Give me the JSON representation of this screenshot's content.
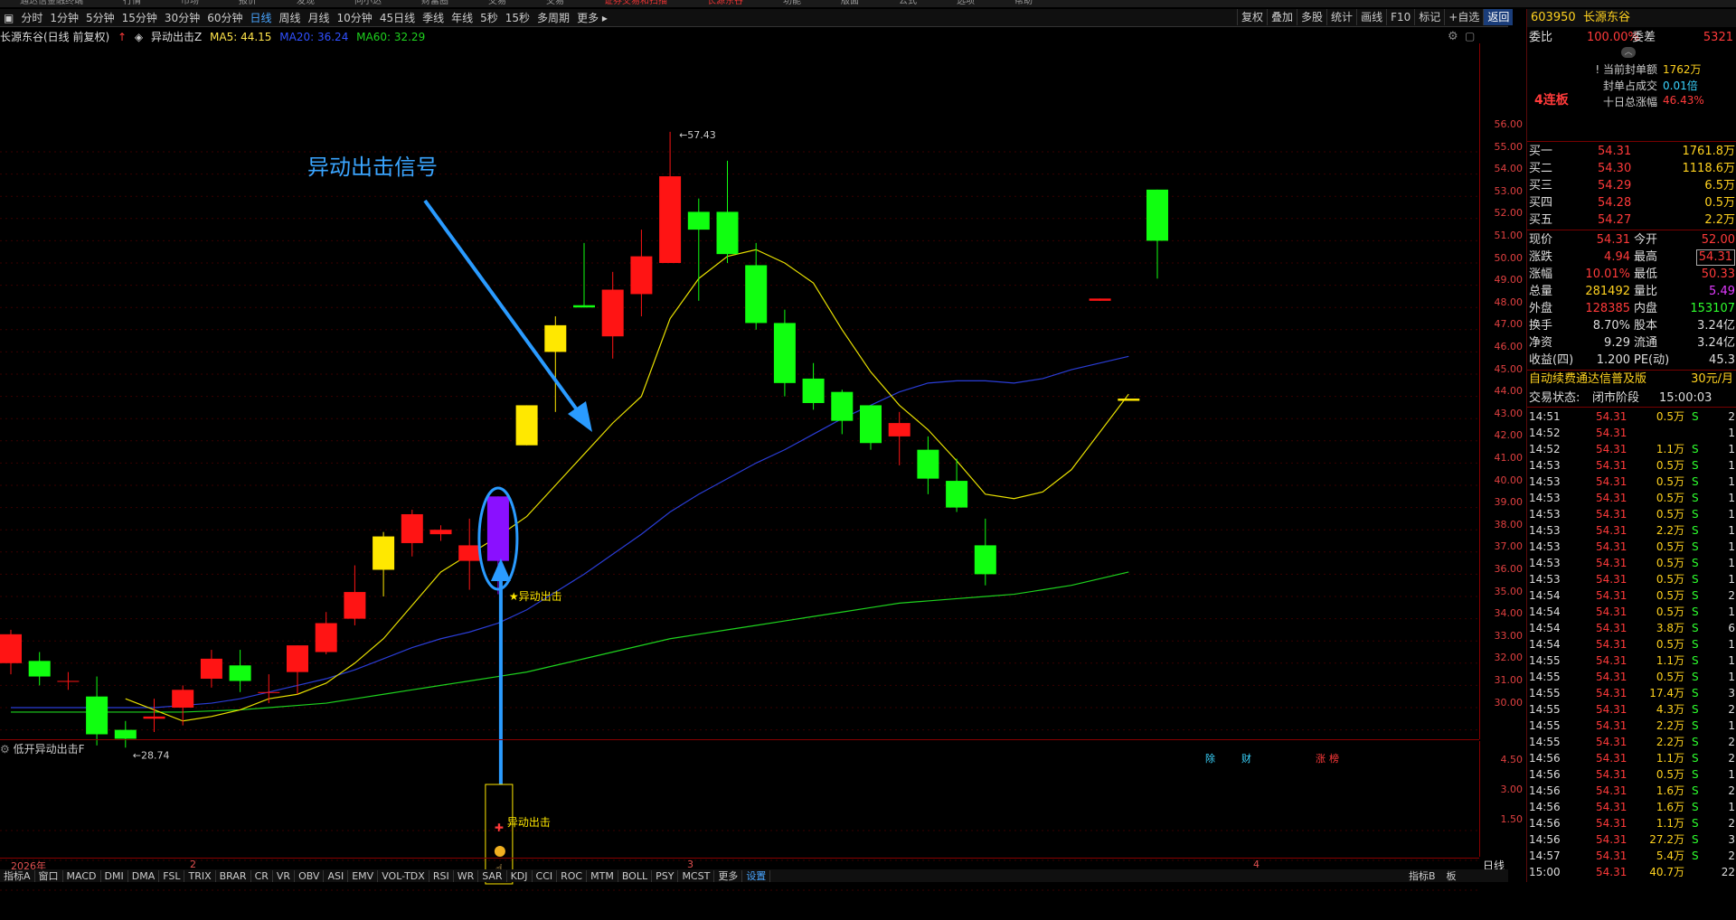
{
  "menubar": [
    "通达信金融终端",
    "行情",
    "市场",
    "报价",
    "发现",
    "问小达",
    "财富圈",
    "交易",
    "交易",
    "证券交易和扫描",
    "长源东谷",
    "功能",
    "版面",
    "公式",
    "选项",
    "帮助"
  ],
  "period_tabs": [
    {
      "label": "分时"
    },
    {
      "label": "1分钟"
    },
    {
      "label": "5分钟"
    },
    {
      "label": "15分钟"
    },
    {
      "label": "30分钟"
    },
    {
      "label": "60分钟"
    },
    {
      "label": "日线",
      "active": true
    },
    {
      "label": "周线"
    },
    {
      "label": "月线"
    },
    {
      "label": "10分钟"
    },
    {
      "label": "45日线"
    },
    {
      "label": "季线"
    },
    {
      "label": "年线"
    },
    {
      "label": "5秒"
    },
    {
      "label": "15秒"
    },
    {
      "label": "多周期"
    },
    {
      "label": "更多 ▸"
    }
  ],
  "toolbar": [
    "复权",
    "叠加",
    "多股",
    "统计",
    "画线",
    "F10",
    "标记",
    "+自选",
    "返回"
  ],
  "info_bar": {
    "stock": "长源东谷(日线 前复权)",
    "indicator": "异动出击Z",
    "ma5": "MA5: 44.15",
    "ma20": "MA20: 36.24",
    "ma60": "MA60: 32.29"
  },
  "chart_data": {
    "type": "candlestick",
    "high_label": "57.43",
    "low_label": "28.74",
    "annotation_title": "异动出击信号",
    "signal_label": "★异动出击",
    "event_tags": [
      "除",
      "财",
      "涨",
      "榜"
    ],
    "y_ticks": [
      "56.00",
      "55.00",
      "54.00",
      "53.00",
      "52.00",
      "51.00",
      "50.00",
      "49.00",
      "48.00",
      "47.00",
      "46.00",
      "45.00",
      "44.00",
      "43.00",
      "42.00",
      "41.00",
      "40.00",
      "39.00",
      "38.00",
      "37.00",
      "36.00",
      "35.00",
      "34.00",
      "33.00",
      "32.00",
      "31.00",
      "30.00"
    ],
    "x_labels": [
      "2026年",
      "2",
      "3",
      "4"
    ],
    "candles": [
      {
        "o": 33.0,
        "h": 34.5,
        "l": 32.5,
        "c": 34.3
      },
      {
        "o": 33.1,
        "h": 33.5,
        "l": 32.0,
        "c": 32.4
      },
      {
        "o": 32.2,
        "h": 32.6,
        "l": 31.8,
        "c": 32.2
      },
      {
        "o": 31.5,
        "h": 32.4,
        "l": 29.3,
        "c": 29.8
      },
      {
        "o": 30.0,
        "h": 30.4,
        "l": 29.2,
        "c": 29.6
      },
      {
        "o": 30.5,
        "h": 31.4,
        "l": 29.9,
        "c": 30.6
      },
      {
        "o": 31.0,
        "h": 32.0,
        "l": 30.2,
        "c": 31.8
      },
      {
        "o": 32.3,
        "h": 33.6,
        "l": 31.9,
        "c": 33.2
      },
      {
        "o": 32.9,
        "h": 33.6,
        "l": 31.7,
        "c": 32.2
      },
      {
        "o": 31.7,
        "h": 32.5,
        "l": 31.2,
        "c": 31.7
      },
      {
        "o": 32.6,
        "h": 33.8,
        "l": 31.6,
        "c": 33.8
      },
      {
        "o": 33.5,
        "h": 35.3,
        "l": 33.4,
        "c": 34.8
      },
      {
        "o": 35.0,
        "h": 37.4,
        "l": 34.7,
        "c": 36.2
      },
      {
        "o": 37.2,
        "h": 38.9,
        "l": 36.0,
        "c": 38.7
      },
      {
        "o": 38.4,
        "h": 39.9,
        "l": 37.8,
        "c": 39.7
      },
      {
        "o": 38.8,
        "h": 39.2,
        "l": 38.5,
        "c": 39.0
      },
      {
        "o": 37.6,
        "h": 39.5,
        "l": 36.3,
        "c": 38.3
      },
      {
        "o": 37.6,
        "h": 40.5,
        "l": 36.1,
        "c": 40.5,
        "signal": true
      },
      {
        "o": 42.8,
        "h": 44.6,
        "l": 42.8,
        "c": 44.6
      },
      {
        "o": 47.0,
        "h": 48.6,
        "l": 44.3,
        "c": 48.2
      },
      {
        "o": 49.1,
        "h": 51.9,
        "l": 49.0,
        "c": 49.0
      },
      {
        "o": 47.7,
        "h": 50.6,
        "l": 46.7,
        "c": 49.8
      },
      {
        "o": 49.6,
        "h": 52.5,
        "l": 48.6,
        "c": 51.3
      },
      {
        "o": 51.0,
        "h": 56.9,
        "l": 51.0,
        "c": 54.9
      },
      {
        "o": 53.3,
        "h": 53.9,
        "l": 49.3,
        "c": 52.5
      },
      {
        "o": 53.3,
        "h": 55.6,
        "l": 51.0,
        "c": 51.4
      },
      {
        "o": 50.9,
        "h": 51.9,
        "l": 48.0,
        "c": 48.3
      },
      {
        "o": 48.3,
        "h": 48.9,
        "l": 45.0,
        "c": 45.6
      },
      {
        "o": 45.8,
        "h": 46.5,
        "l": 44.4,
        "c": 44.7
      },
      {
        "o": 45.2,
        "h": 45.3,
        "l": 43.3,
        "c": 43.9
      },
      {
        "o": 44.6,
        "h": 44.6,
        "l": 42.6,
        "c": 42.9
      },
      {
        "o": 43.2,
        "h": 44.3,
        "l": 41.9,
        "c": 43.8
      },
      {
        "o": 42.6,
        "h": 43.2,
        "l": 40.6,
        "c": 41.3
      },
      {
        "o": 41.2,
        "h": 42.2,
        "l": 39.8,
        "c": 40.0
      },
      {
        "o": 38.3,
        "h": 39.5,
        "l": 36.5,
        "c": 37.0
      },
      null,
      null,
      null,
      {
        "o": 49.3,
        "h": 49.4,
        "l": 49.3,
        "c": 49.4
      },
      {
        "o": 44.8,
        "h": 44.9,
        "l": 44.8,
        "c": 44.9
      },
      {
        "o": 54.3,
        "h": 54.3,
        "l": 50.3,
        "c": 52.0
      }
    ],
    "ma5": [
      null,
      null,
      null,
      null,
      31.4,
      30.9,
      30.4,
      30.6,
      30.9,
      31.4,
      31.6,
      32.1,
      33.0,
      34.1,
      35.6,
      37.1,
      37.9,
      38.7,
      39.6,
      41.0,
      42.4,
      43.8,
      45.0,
      48.5,
      50.3,
      51.3,
      51.6,
      51.0,
      50.1,
      48.0,
      46.1,
      44.6,
      43.5,
      42.1,
      40.6,
      40.4,
      40.7,
      41.7,
      43.4,
      45.1
    ],
    "ma20": [
      31.0,
      31.0,
      31.0,
      31.0,
      31.0,
      31.0,
      31.1,
      31.2,
      31.4,
      31.7,
      32.0,
      32.3,
      32.7,
      33.2,
      33.7,
      34.1,
      34.4,
      34.8,
      35.4,
      36.2,
      37.0,
      37.9,
      38.8,
      39.8,
      40.6,
      41.3,
      42.0,
      42.6,
      43.3,
      44.0,
      44.6,
      45.2,
      45.6,
      45.7,
      45.7,
      45.6,
      45.8,
      46.2,
      46.5,
      46.8
    ],
    "ma60": [
      30.8,
      30.8,
      30.8,
      30.8,
      30.8,
      30.8,
      30.8,
      30.85,
      30.9,
      31.0,
      31.1,
      31.2,
      31.4,
      31.6,
      31.8,
      32.0,
      32.2,
      32.4,
      32.6,
      32.9,
      33.2,
      33.5,
      33.8,
      34.1,
      34.3,
      34.5,
      34.7,
      34.9,
      35.1,
      35.3,
      35.5,
      35.7,
      35.8,
      35.9,
      36.0,
      36.1,
      36.3,
      36.5,
      36.8,
      37.1
    ]
  },
  "sub_chart": {
    "title": "低开异动出击F",
    "signal_label": "异动出击",
    "y_ticks": [
      "4.50",
      "3.00",
      "1.50"
    ]
  },
  "bottom_tabs": [
    "指标A",
    "窗口",
    "MACD",
    "DMI",
    "DMA",
    "FSL",
    "TRIX",
    "BRAR",
    "CR",
    "VR",
    "OBV",
    "ASI",
    "EMV",
    "VOL-TDX",
    "RSI",
    "WR",
    "SAR",
    "KDJ",
    "CCI",
    "ROC",
    "MTM",
    "BOLL",
    "PSY",
    "MCST",
    "更多",
    "设置"
  ],
  "bottom_right": [
    "指标B",
    "板"
  ],
  "period_label": "日线",
  "quote": {
    "code": "603950",
    "name": "长源东谷",
    "weibi_label": "委比",
    "weibi_value": "100.00%",
    "weicha_label": "委差",
    "weicha_value": "5321",
    "streak": "4连板",
    "seal_lines": [
      {
        "label": "! 当前封单额",
        "value": "1762万"
      },
      {
        "label": "封单占成交",
        "value": "0.01倍"
      },
      {
        "label": "十日总涨幅",
        "value": "46.43%"
      }
    ],
    "bids": [
      {
        "label": "买一",
        "price": "54.31",
        "vol": "1761.8万"
      },
      {
        "label": "买二",
        "price": "54.30",
        "vol": "1118.6万"
      },
      {
        "label": "买三",
        "price": "54.29",
        "vol": "6.5万"
      },
      {
        "label": "买四",
        "price": "54.28",
        "vol": "0.5万"
      },
      {
        "label": "买五",
        "price": "54.27",
        "vol": "2.2万"
      }
    ],
    "stats": [
      {
        "l1": "现价",
        "v1": "54.31",
        "c1": "red",
        "l2": "今开",
        "v2": "52.00",
        "c2": "red"
      },
      {
        "l1": "涨跌",
        "v1": "4.94",
        "c1": "red",
        "l2": "最高",
        "v2": "54.31",
        "c2": "red"
      },
      {
        "l1": "涨幅",
        "v1": "10.01%",
        "c1": "red",
        "l2": "最低",
        "v2": "50.33",
        "c2": "red"
      },
      {
        "l1": "总量",
        "v1": "281492",
        "c1": "yel",
        "l2": "量比",
        "v2": "5.49",
        "c2": "mag"
      },
      {
        "l1": "外盘",
        "v1": "128385",
        "c1": "red",
        "l2": "内盘",
        "v2": "153107",
        "c2": "grn"
      },
      {
        "l1": "换手",
        "v1": "8.70%",
        "c1": "wht",
        "l2": "股本",
        "v2": "3.24亿",
        "c2": "wht"
      },
      {
        "l1": "净资",
        "v1": "9.29",
        "c1": "wht",
        "l2": "流通",
        "v2": "3.24亿",
        "c2": "wht"
      },
      {
        "l1": "收益(四)",
        "v1": "1.200",
        "c1": "wht",
        "l2": "PE(动)",
        "v2": "45.3",
        "c2": "wht"
      }
    ],
    "ad": "自动续费通达信普及版",
    "ad_price": "30元/月",
    "status_label": "交易状态:",
    "status": "闭市阶段",
    "status_time": "15:00:03",
    "ticks": [
      {
        "t": "14:51",
        "p": "54.31",
        "v": "0.5万",
        "s": "S",
        "n": "2"
      },
      {
        "t": "14:52",
        "p": "54.31",
        "v": "",
        "s": "",
        "n": "1"
      },
      {
        "t": "14:52",
        "p": "54.31",
        "v": "1.1万",
        "s": "S",
        "n": "1"
      },
      {
        "t": "14:53",
        "p": "54.31",
        "v": "0.5万",
        "s": "S",
        "n": "1"
      },
      {
        "t": "14:53",
        "p": "54.31",
        "v": "0.5万",
        "s": "S",
        "n": "1"
      },
      {
        "t": "14:53",
        "p": "54.31",
        "v": "0.5万",
        "s": "S",
        "n": "1"
      },
      {
        "t": "14:53",
        "p": "54.31",
        "v": "0.5万",
        "s": "S",
        "n": "1"
      },
      {
        "t": "14:53",
        "p": "54.31",
        "v": "2.2万",
        "s": "S",
        "n": "1"
      },
      {
        "t": "14:53",
        "p": "54.31",
        "v": "0.5万",
        "s": "S",
        "n": "1"
      },
      {
        "t": "14:53",
        "p": "54.31",
        "v": "0.5万",
        "s": "S",
        "n": "1"
      },
      {
        "t": "14:53",
        "p": "54.31",
        "v": "0.5万",
        "s": "S",
        "n": "1"
      },
      {
        "t": "14:54",
        "p": "54.31",
        "v": "0.5万",
        "s": "S",
        "n": "2"
      },
      {
        "t": "14:54",
        "p": "54.31",
        "v": "0.5万",
        "s": "S",
        "n": "1"
      },
      {
        "t": "14:54",
        "p": "54.31",
        "v": "3.8万",
        "s": "S",
        "n": "6"
      },
      {
        "t": "14:54",
        "p": "54.31",
        "v": "0.5万",
        "s": "S",
        "n": "1"
      },
      {
        "t": "14:55",
        "p": "54.31",
        "v": "1.1万",
        "s": "S",
        "n": "1"
      },
      {
        "t": "14:55",
        "p": "54.31",
        "v": "0.5万",
        "s": "S",
        "n": "1"
      },
      {
        "t": "14:55",
        "p": "54.31",
        "v": "17.4万",
        "s": "S",
        "n": "3"
      },
      {
        "t": "14:55",
        "p": "54.31",
        "v": "4.3万",
        "s": "S",
        "n": "2"
      },
      {
        "t": "14:55",
        "p": "54.31",
        "v": "2.2万",
        "s": "S",
        "n": "1"
      },
      {
        "t": "14:55",
        "p": "54.31",
        "v": "2.2万",
        "s": "S",
        "n": "2"
      },
      {
        "t": "14:56",
        "p": "54.31",
        "v": "1.1万",
        "s": "S",
        "n": "2"
      },
      {
        "t": "14:56",
        "p": "54.31",
        "v": "0.5万",
        "s": "S",
        "n": "1"
      },
      {
        "t": "14:56",
        "p": "54.31",
        "v": "1.6万",
        "s": "S",
        "n": "2"
      },
      {
        "t": "14:56",
        "p": "54.31",
        "v": "1.6万",
        "s": "S",
        "n": "1"
      },
      {
        "t": "14:56",
        "p": "54.31",
        "v": "1.1万",
        "s": "S",
        "n": "2"
      },
      {
        "t": "14:56",
        "p": "54.31",
        "v": "27.2万",
        "s": "S",
        "n": "3"
      },
      {
        "t": "14:57",
        "p": "54.31",
        "v": "5.4万",
        "s": "S",
        "n": "2"
      },
      {
        "t": "15:00",
        "p": "54.31",
        "v": "40.7万",
        "s": "",
        "n": "22"
      }
    ]
  }
}
